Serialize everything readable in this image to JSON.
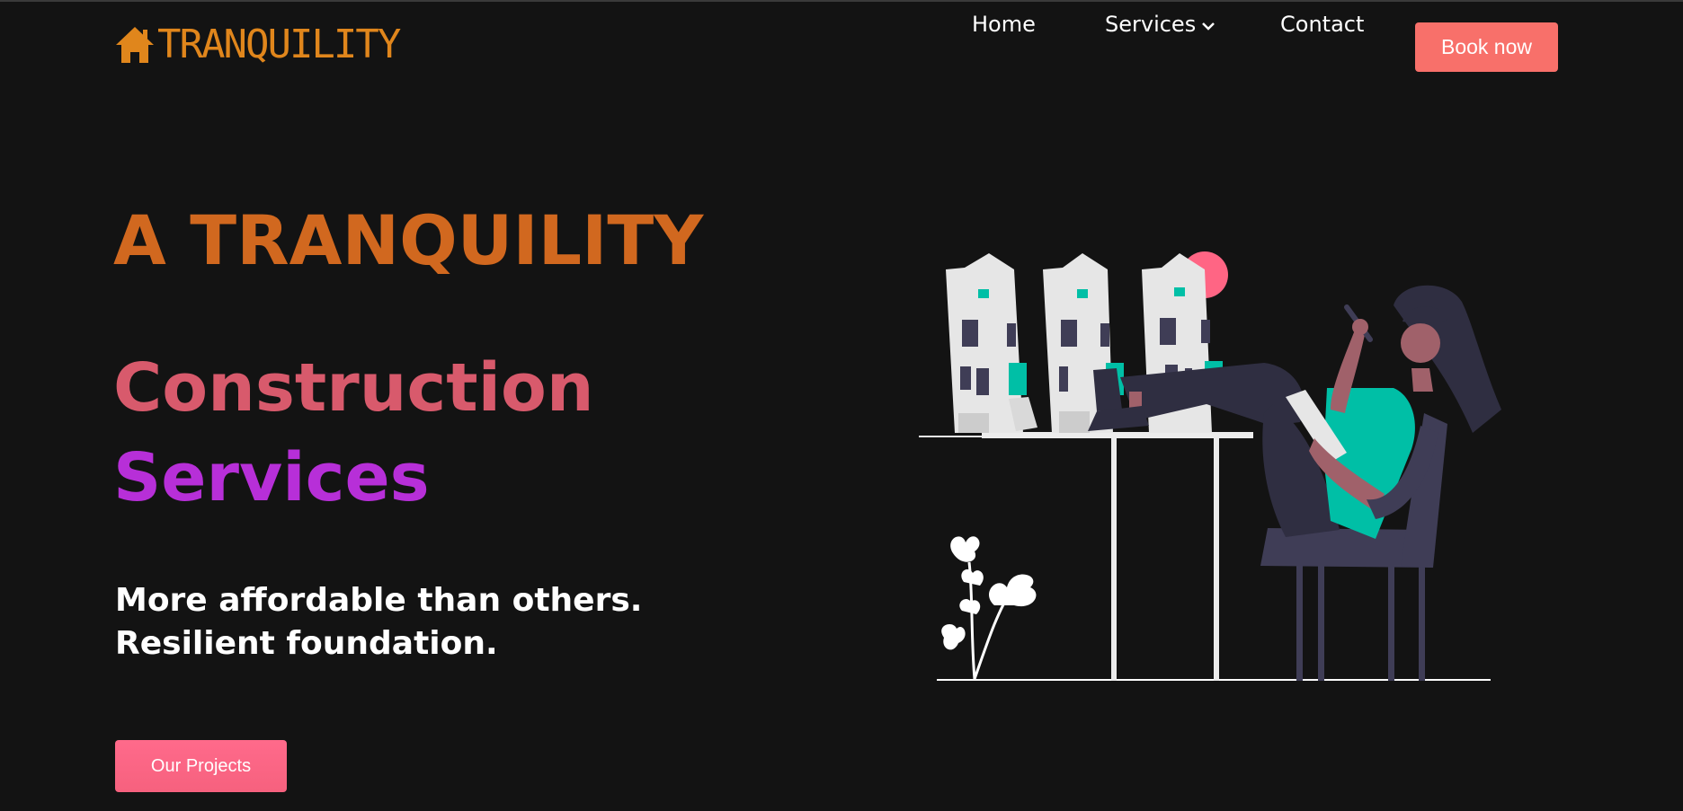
{
  "brand": {
    "name": "TRANQUILITY",
    "color": "#e0861c"
  },
  "nav": {
    "home": "Home",
    "services": "Services",
    "contact": "Contact",
    "book": "Book now",
    "book_color": "#f8706a"
  },
  "hero": {
    "title": "A TRANQUILITY",
    "line2": "Construction",
    "line3": "Services",
    "subtitle": "More affordable than others. Resilient foundation.",
    "cta": "Our Projects"
  },
  "icons": {
    "logo": "house-icon",
    "services_dropdown": "chevron-down-icon"
  },
  "colors": {
    "background": "#131313",
    "title": "#d1681f",
    "line2": "#d85a6c",
    "line3": "#b72fd8",
    "cta": "#ff6a8b"
  }
}
